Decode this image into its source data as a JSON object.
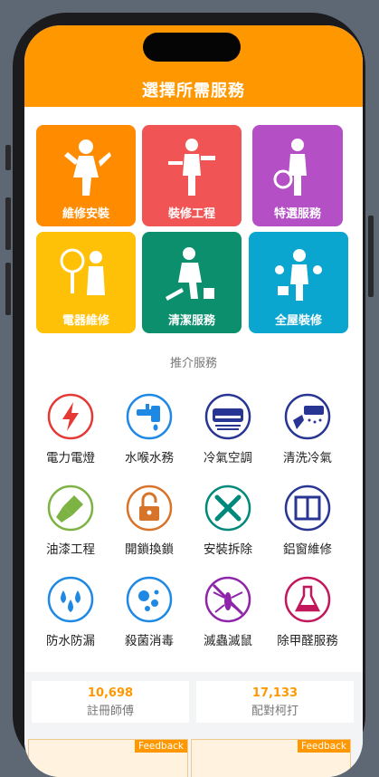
{
  "header": {
    "title": "選擇所需服務"
  },
  "categories": [
    {
      "label": "維修安裝",
      "color": "#ff8c00",
      "icon": "repair-worker-icon"
    },
    {
      "label": "裝修工程",
      "color": "#f05454",
      "icon": "renovation-worker-icon"
    },
    {
      "label": "特選服務",
      "color": "#b44fc6",
      "icon": "special-service-icon"
    },
    {
      "label": "電器維修",
      "color": "#ffc107",
      "icon": "appliance-repair-icon"
    },
    {
      "label": "清潔服務",
      "color": "#0c8f6d",
      "icon": "cleaning-worker-icon"
    },
    {
      "label": "全屋裝修",
      "color": "#0aa6cf",
      "icon": "whole-house-icon"
    }
  ],
  "recommend": {
    "title": "推介服務",
    "items": [
      {
        "label": "電力電燈",
        "color": "#e53935",
        "icon": "lightning-icon"
      },
      {
        "label": "水喉水務",
        "color": "#1e88e5",
        "icon": "faucet-icon"
      },
      {
        "label": "冷氣空調",
        "color": "#283593",
        "icon": "air-conditioner-icon"
      },
      {
        "label": "清洗冷氣",
        "color": "#283593",
        "icon": "aircon-cleaning-icon"
      },
      {
        "label": "油漆工程",
        "color": "#7cb342",
        "icon": "paint-brush-icon"
      },
      {
        "label": "開鎖換鎖",
        "color": "#d8732a",
        "icon": "padlock-icon"
      },
      {
        "label": "安裝拆除",
        "color": "#00897b",
        "icon": "tools-icon"
      },
      {
        "label": "鋁窗維修",
        "color": "#283593",
        "icon": "window-icon"
      },
      {
        "label": "防水防漏",
        "color": "#1e88e5",
        "icon": "water-drops-icon"
      },
      {
        "label": "殺菌消毒",
        "color": "#1e88e5",
        "icon": "disinfection-icon"
      },
      {
        "label": "滅蟲滅鼠",
        "color": "#8e24aa",
        "icon": "mosquito-icon"
      },
      {
        "label": "除甲醛服務",
        "color": "#c2185b",
        "icon": "chemical-flask-icon"
      }
    ]
  },
  "stats": [
    {
      "value": "10,698",
      "label": "註冊師傅"
    },
    {
      "value": "17,133",
      "label": "配對柯打"
    }
  ],
  "banners": [
    {
      "feedback": "Feedback"
    },
    {
      "feedback": "Feedback"
    }
  ]
}
